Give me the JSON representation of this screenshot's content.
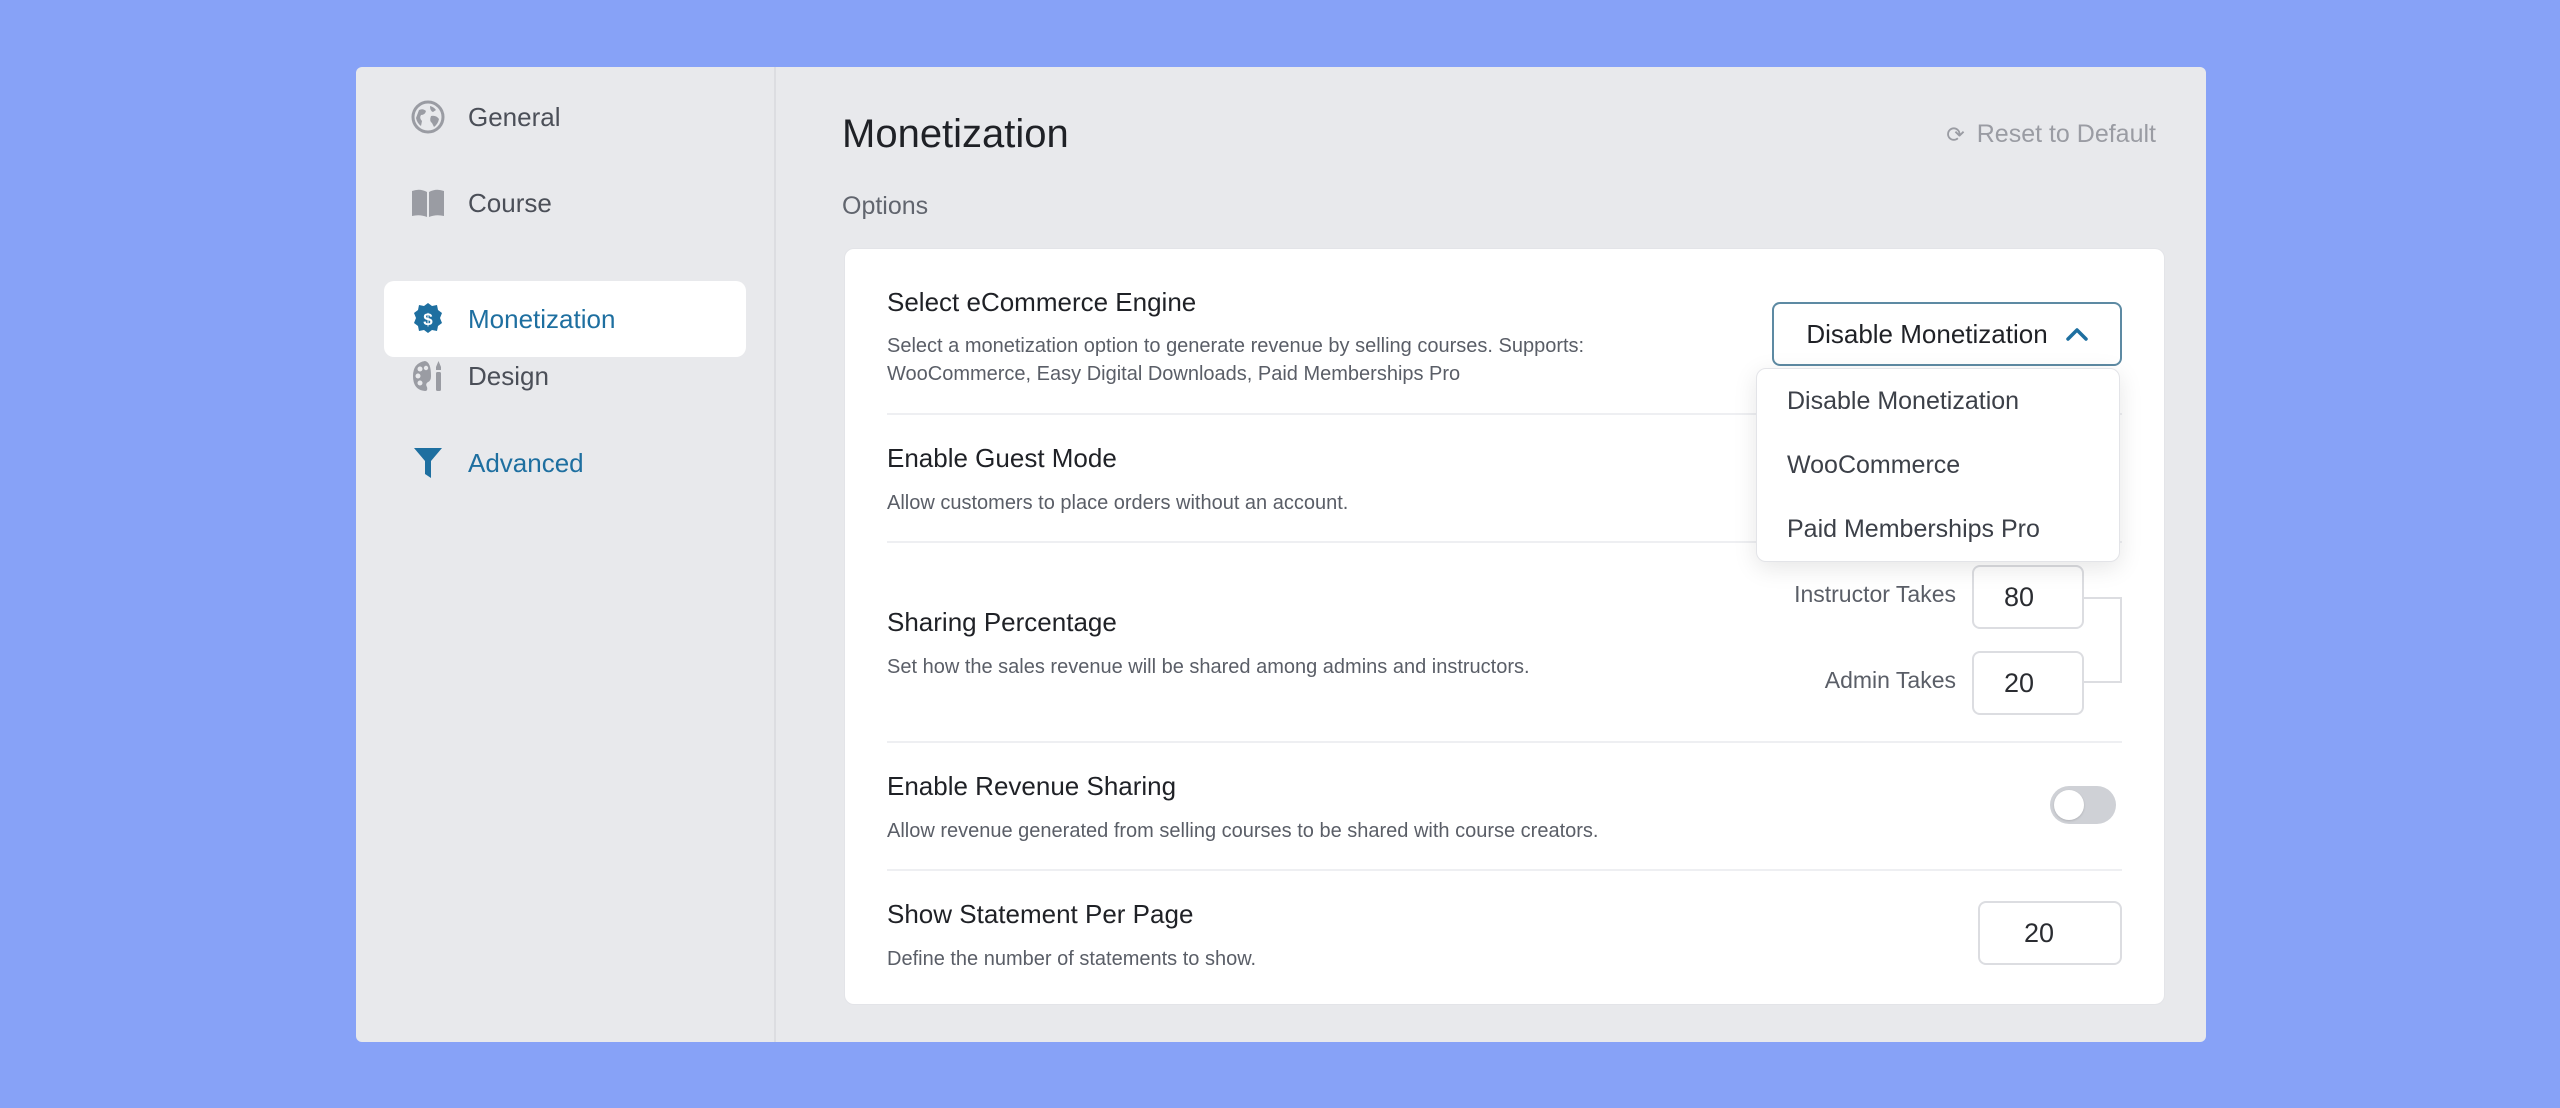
{
  "sidebar": {
    "items": [
      {
        "label": "General",
        "icon": "globe-icon",
        "active": false
      },
      {
        "label": "Course",
        "icon": "book-icon",
        "active": false
      },
      {
        "label": "Monetization",
        "icon": "dollar-badge-icon",
        "active": true
      },
      {
        "label": "Design",
        "icon": "palette-icon",
        "active": false
      },
      {
        "label": "Advanced",
        "icon": "filter-icon",
        "active": false
      }
    ]
  },
  "header": {
    "title": "Monetization",
    "reset_label": "Reset to Default",
    "reset_icon": "refresh-icon",
    "section_label": "Options"
  },
  "settings": {
    "ecommerce": {
      "title": "Select eCommerce Engine",
      "description": "Select a monetization option to generate revenue by selling courses. Supports: WooCommerce, Easy Digital Downloads, Paid Memberships Pro",
      "selected": "Disable Monetization",
      "options": [
        "Disable Monetization",
        "WooCommerce",
        "Paid Memberships Pro"
      ]
    },
    "guest_mode": {
      "title": "Enable Guest Mode",
      "description": "Allow customers to place orders without an account."
    },
    "sharing": {
      "title": "Sharing Percentage",
      "description": "Set how the sales revenue will be shared among admins and instructors.",
      "instructor_label": "Instructor Takes",
      "instructor_value": "80",
      "admin_label": "Admin Takes",
      "admin_value": "20"
    },
    "revenue_sharing": {
      "title": "Enable Revenue Sharing",
      "description": "Allow revenue generated from selling courses to be shared with course creators.",
      "enabled": false
    },
    "statements": {
      "title": "Show Statement Per Page",
      "description": "Define the number of statements to show.",
      "value": "20"
    }
  },
  "colors": {
    "background": "#87a2f7",
    "accent": "#1e6fa0",
    "panel": "#e8e9ec"
  }
}
